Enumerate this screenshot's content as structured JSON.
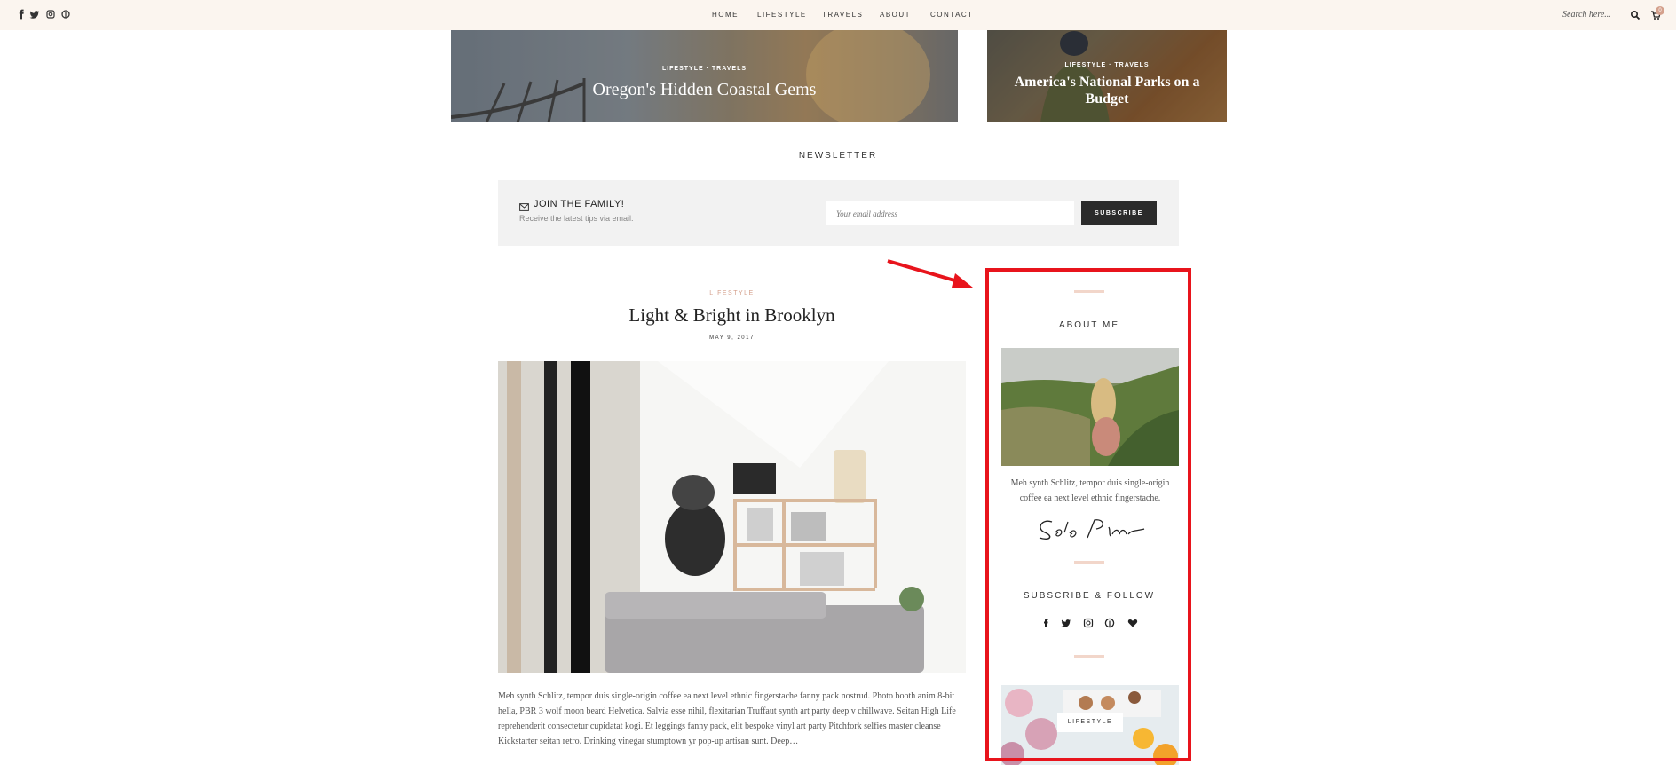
{
  "header": {
    "social": [
      "facebook-icon",
      "twitter-icon",
      "instagram-icon",
      "pinterest-icon"
    ],
    "nav": [
      "HOME",
      "LIFESTYLE",
      "TRAVELS",
      "ABOUT",
      "CONTACT"
    ],
    "search_placeholder": "Search here...",
    "cart_count": "0"
  },
  "featured": [
    {
      "category": "LIFESTYLE · TRAVELS",
      "title": "Oregon's Hidden Coastal Gems"
    },
    {
      "category": "LIFESTYLE · TRAVELS",
      "title": "America's National Parks on a Budget"
    }
  ],
  "newsletter": {
    "heading": "NEWSLETTER",
    "title": "JOIN THE FAMILY!",
    "subtitle": "Receive the latest tips via email.",
    "email_placeholder": "Your email address",
    "button": "SUBSCRIBE"
  },
  "post": {
    "category": "LIFESTYLE",
    "title": "Light & Bright in Brooklyn",
    "date": "MAY 9, 2017",
    "excerpt": "Meh synth Schlitz, tempor duis single-origin coffee ea next level ethnic fingerstache fanny pack nostrud. Photo booth anim 8-bit hella, PBR 3 wolf moon beard Helvetica. Salvia esse nihil, flexitarian Truffaut synth art party deep v chillwave. Seitan High Life reprehenderit consectetur cupidatat kogi. Et leggings fanny pack, elit bespoke vinyl art party Pitchfork selfies master cleanse Kickstarter seitan retro. Drinking vinegar stumptown yr pop-up artisan sunt. Deep…"
  },
  "sidebar": {
    "about_title": "ABOUT ME",
    "about_text": "Meh synth Schlitz, tempor duis single-origin coffee ea next level ethnic fingerstache.",
    "signature": "Solo Pine",
    "follow_title": "SUBSCRIBE & FOLLOW",
    "follow_icons": [
      "facebook-icon",
      "twitter-icon",
      "instagram-icon",
      "pinterest-icon",
      "bloglovin-heart-icon"
    ],
    "category_label": "LIFESTYLE"
  },
  "annotation": {
    "color": "#e8141c"
  },
  "colors": {
    "accent": "#d4a08c",
    "topbar_bg": "#fbf5ef",
    "button_bg": "#2b2b2b"
  }
}
